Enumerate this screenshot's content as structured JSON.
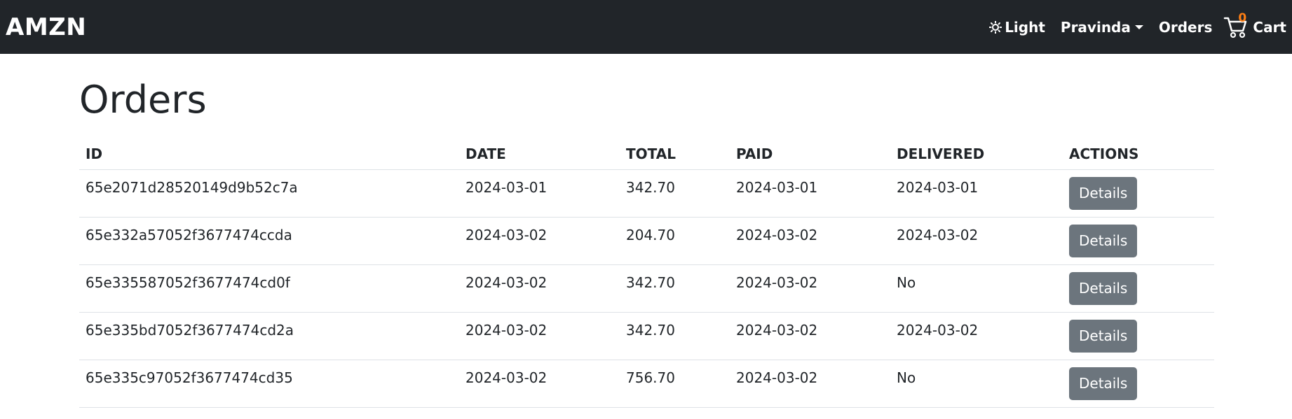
{
  "navbar": {
    "brand": "AMZN",
    "theme_label": "Light",
    "user_label": "Pravinda",
    "orders_label": "Orders",
    "cart_count": "0",
    "cart_label": "Cart"
  },
  "page": {
    "title": "Orders"
  },
  "table": {
    "headers": [
      "ID",
      "DATE",
      "TOTAL",
      "PAID",
      "DELIVERED",
      "ACTIONS"
    ],
    "rows": [
      {
        "id": "65e2071d28520149d9b52c7a",
        "date": "2024-03-01",
        "total": "342.70",
        "paid": "2024-03-01",
        "delivered": "2024-03-01",
        "action": "Details"
      },
      {
        "id": "65e332a57052f3677474ccda",
        "date": "2024-03-02",
        "total": "204.70",
        "paid": "2024-03-02",
        "delivered": "2024-03-02",
        "action": "Details"
      },
      {
        "id": "65e335587052f3677474cd0f",
        "date": "2024-03-02",
        "total": "342.70",
        "paid": "2024-03-02",
        "delivered": "No",
        "action": "Details"
      },
      {
        "id": "65e335bd7052f3677474cd2a",
        "date": "2024-03-02",
        "total": "342.70",
        "paid": "2024-03-02",
        "delivered": "2024-03-02",
        "action": "Details"
      },
      {
        "id": "65e335c97052f3677474cd35",
        "date": "2024-03-02",
        "total": "756.70",
        "paid": "2024-03-02",
        "delivered": "No",
        "action": "Details"
      }
    ]
  },
  "colors": {
    "navbar_bg": "#212529",
    "cart_badge": "#fd7e14",
    "button_bg": "#6c757d"
  }
}
